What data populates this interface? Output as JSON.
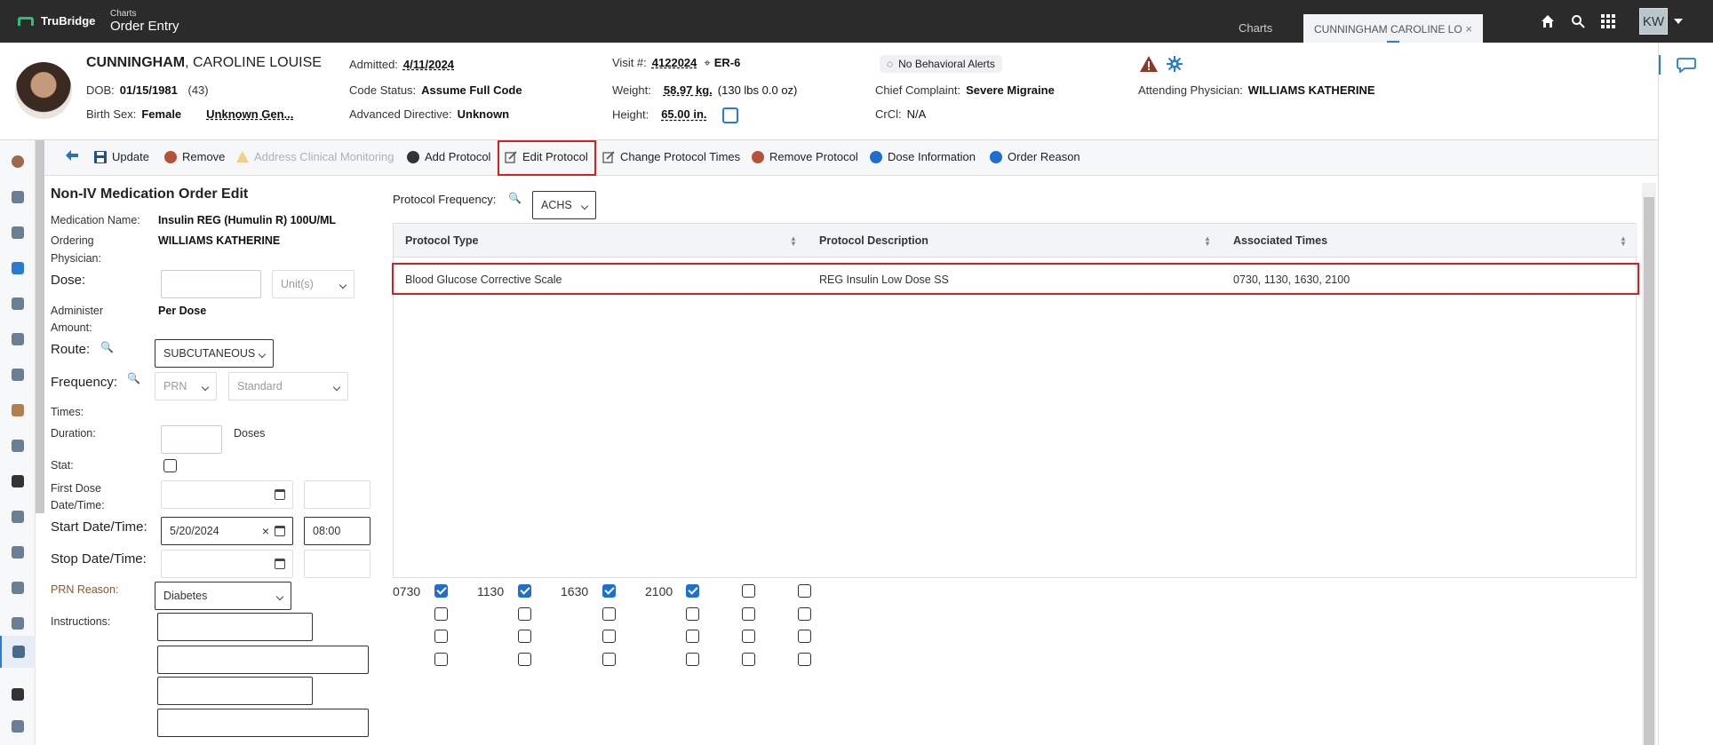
{
  "app": {
    "brand": "TruBridge",
    "section_small": "Charts",
    "section_title": "Order Entry"
  },
  "tabs": {
    "charts_label": "Charts",
    "patient_tab_label": "CUNNINGHAM CAROLINE LO",
    "close_symbol": "×"
  },
  "user": {
    "initials": "KW"
  },
  "patient": {
    "last_name": "CUNNINGHAM",
    "first_names": ", CAROLINE LOUISE",
    "dob_label": "DOB:",
    "dob": "01/15/1981",
    "age": "(43)",
    "birth_sex_label": "Birth Sex:",
    "birth_sex": "Female",
    "gender": "Unknown Gen...",
    "admitted_label": "Admitted:",
    "admitted": "4/11/2024",
    "code_status_label": "Code Status:",
    "code_status": "Assume Full Code",
    "advanced_directive_label": "Advanced Directive:",
    "advanced_directive": "Unknown",
    "visit_label": "Visit #:",
    "visit": "4122024",
    "location": "ER-6",
    "weight_label": "Weight:",
    "weight": "58.97 kg.",
    "weight_alt": "(130 lbs 0.0 oz)",
    "height_label": "Height:",
    "height": "65.00 in.",
    "behavioral_alerts": "No Behavioral Alerts",
    "chief_complaint_label": "Chief Complaint:",
    "chief_complaint": "Severe Migraine",
    "crcl_label": "CrCl:",
    "crcl": "N/A",
    "attending_label": "Attending Physician:",
    "attending": "WILLIAMS KATHERINE"
  },
  "toolbar": {
    "update": "Update",
    "remove": "Remove",
    "address_clinical": "Address Clinical Monitoring",
    "add_protocol": "Add Protocol",
    "edit_protocol": "Edit Protocol",
    "change_protocol_times": "Change Protocol Times",
    "remove_protocol": "Remove Protocol",
    "dose_information": "Dose Information",
    "order_reason": "Order Reason"
  },
  "form": {
    "title": "Non-IV Medication Order Edit",
    "medication_name_label": "Medication Name:",
    "medication_name": "Insulin REG (Humulin R) 100U/ML",
    "ordering_label_1": "Ordering",
    "ordering_label_2": "Physician:",
    "ordering_physician": "WILLIAMS KATHERINE",
    "dose_label": "Dose:",
    "unit_placeholder": "Unit(s)",
    "administer_label_1": "Administer",
    "administer_label_2": "Amount:",
    "administer_amount": "Per Dose",
    "route_label": "Route:",
    "route": "SUBCUTANEOUS",
    "frequency_label": "Frequency:",
    "frequency": "PRN",
    "frequency_type": "Standard",
    "times_label": "Times:",
    "duration_label": "Duration:",
    "duration_unit": "Doses",
    "stat_label": "Stat:",
    "first_dose_label_1": "First Dose",
    "first_dose_label_2": "Date/Time:",
    "start_label": "Start Date/Time:",
    "start_date": "5/20/2024",
    "start_time": "08:00",
    "stop_label": "Stop Date/Time:",
    "prn_reason_label": "PRN Reason:",
    "prn_reason": "Diabetes",
    "instructions_label": "Instructions:"
  },
  "protocol": {
    "frequency_label": "Protocol Frequency:",
    "frequency": "ACHS",
    "columns": [
      "Protocol Type",
      "Protocol Description",
      "Associated Times"
    ],
    "rows": [
      {
        "type": "Blood Glucose Corrective Scale",
        "description": "REG Insulin Low Dose SS",
        "times": "0730, 1130, 1630, 2100"
      }
    ],
    "time_labels": [
      "0730",
      "1130",
      "1630",
      "2100"
    ],
    "time_checks": [
      true,
      true,
      true,
      true,
      false,
      false
    ]
  },
  "colors": {
    "topbar": "#2b2b2b",
    "accent": "#1f6fd0",
    "highlight": "#d62020"
  }
}
